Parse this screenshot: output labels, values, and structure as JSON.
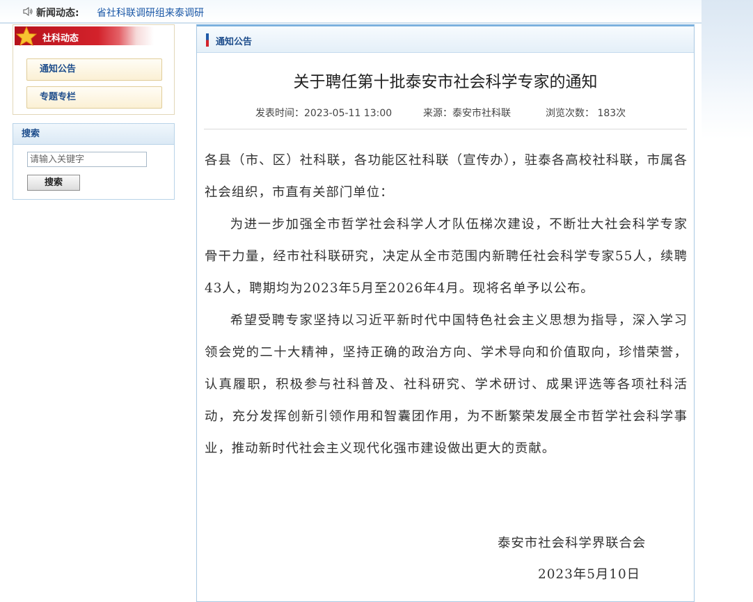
{
  "news": {
    "label": "新闻动态:",
    "headline": "省社科联调研组来泰调研"
  },
  "sidebar": {
    "section_title": "社科动态",
    "items": [
      {
        "label": "通知公告"
      },
      {
        "label": "专题专栏"
      }
    ]
  },
  "search": {
    "title": "搜索",
    "placeholder": "请输入关键字",
    "button_label": "搜索"
  },
  "main": {
    "section_label": "通知公告",
    "article": {
      "title": "关于聘任第十批泰安市社会科学专家的通知",
      "published": "发表时间：2023-05-11 13:00",
      "source": "来源：泰安市社科联",
      "views": "浏览次数： 183次",
      "salutation": "各县（市、区）社科联，各功能区社科联（宣传办），驻泰各高校社科联，市属各社会组织，市直有关部门单位：",
      "paragraphs": [
        "为进一步加强全市哲学社会科学人才队伍梯次建设，不断壮大社会科学专家骨干力量，经市社科联研究，决定从全市范围内新聘任社会科学专家55人，续聘43人，聘期均为2023年5月至2026年4月。现将名单予以公布。",
        "希望受聘专家坚持以习近平新时代中国特色社会主义思想为指导，深入学习领会党的二十大精神，坚持正确的政治方向、学术导向和价值取向，珍惜荣誉，认真履职，积极参与社科普及、社科研究、学术研讨、成果评选等各项社科活动，充分发挥创新引领作用和智囊团作用，为不断繁荣发展全市哲学社会科学事业，推动新时代社会主义现代化强市建设做出更大的贡献。"
      ],
      "signature": "泰安市社会科学界联合会",
      "date": "2023年5月10日"
    }
  },
  "colors": {
    "link_blue": "#1a57a6",
    "ribbon_red": "#c8161e",
    "panel_border": "#a9c8e2"
  },
  "icons": [
    "speaker-icon",
    "star-icon"
  ]
}
